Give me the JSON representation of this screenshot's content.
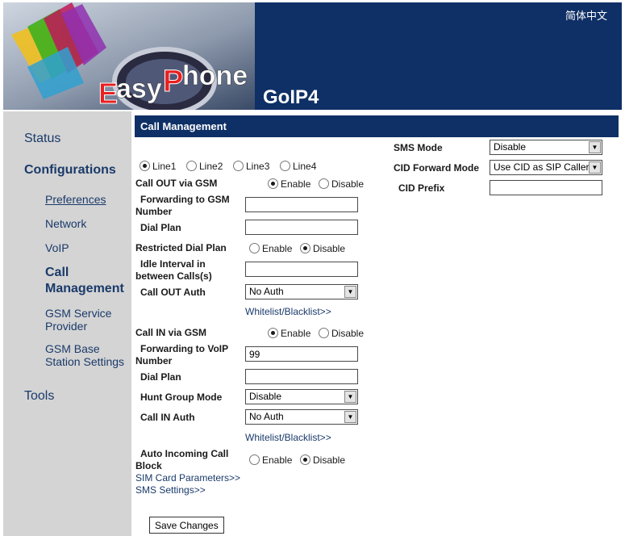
{
  "header": {
    "logo_text": "EasyPhone",
    "model": "GoIP4",
    "language_link": "简体中文"
  },
  "sidebar": {
    "status": "Status",
    "configurations": "Configurations",
    "items": [
      {
        "label": "Preferences"
      },
      {
        "label": "Network"
      },
      {
        "label": "VoIP"
      },
      {
        "label": "Call Management"
      },
      {
        "label": "GSM Service Provider"
      },
      {
        "label": "GSM Base Station Settings"
      }
    ],
    "tools": "Tools"
  },
  "section": {
    "title": "Call Management"
  },
  "lines": [
    "Line1",
    "Line2",
    "Line3",
    "Line4"
  ],
  "selected_line": "Line1",
  "call_out": {
    "label": "Call OUT via GSM",
    "state": "Enable",
    "forwarding_label": "Forwarding to GSM Number",
    "forwarding_value": "",
    "dial_plan_label": "Dial Plan",
    "dial_plan_value": "",
    "restricted_label": "Restricted Dial Plan",
    "restricted_state": "Disable",
    "idle_label": "Idle Interval in between Calls(s)",
    "idle_value": "",
    "auth_label": "Call OUT Auth",
    "auth_value": "No Auth",
    "list_link": "Whitelist/Blacklist>>"
  },
  "call_in": {
    "label": "Call IN via GSM",
    "state": "Enable",
    "forwarding_label": "Forwarding to VoIP Number",
    "forwarding_value": "99",
    "dial_plan_label": "Dial Plan",
    "dial_plan_value": "",
    "hunt_label": "Hunt Group Mode",
    "hunt_value": "Disable",
    "auth_label": "Call IN Auth",
    "auth_value": "No Auth",
    "list_link": "Whitelist/Blacklist>>"
  },
  "auto_block": {
    "label": "Auto Incoming Call Block",
    "state": "Disable"
  },
  "radio_labels": {
    "enable": "Enable",
    "disable": "Disable"
  },
  "links": {
    "sim": "SIM Card Parameters>>",
    "sms": "SMS Settings>>"
  },
  "right": {
    "sms_mode_label": "SMS Mode",
    "sms_mode_value": "Disable",
    "cid_forward_label": "CID Forward Mode",
    "cid_forward_value": "Use CID as SIP Caller",
    "cid_prefix_label": "CID Prefix",
    "cid_prefix_value": ""
  },
  "save_label": "Save Changes",
  "colors": {
    "header_bg": "#0f3066",
    "sidebar_bg": "#d4d4d4",
    "link": "#1a3a6a"
  }
}
